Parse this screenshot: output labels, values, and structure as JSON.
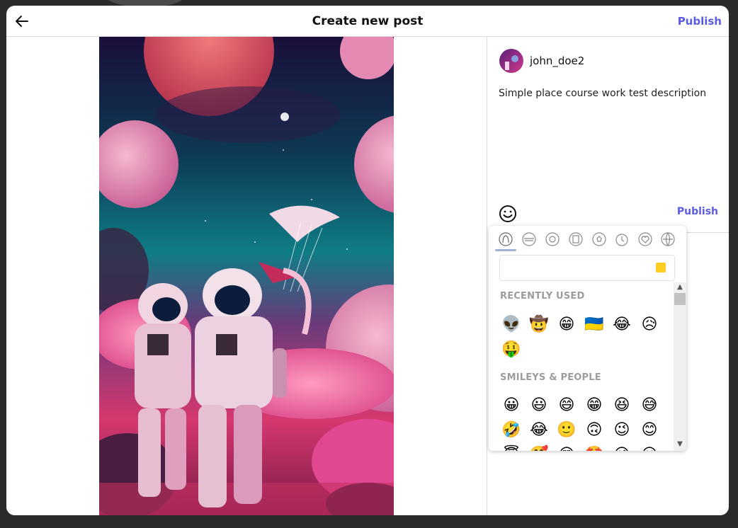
{
  "modal": {
    "title": "Create new post",
    "publish_label": "Publish",
    "back_icon": "arrow-left-icon"
  },
  "image": {
    "description_icon": "post-image"
  },
  "user": {
    "username": "john_doe2"
  },
  "caption": {
    "text": "Simple place course work test description"
  },
  "composer": {
    "emoji_icon": "smiley-icon",
    "publish_label": "Publish"
  },
  "emoji_picker": {
    "categories": [
      "people-icon",
      "food-icon",
      "activity-icon",
      "travel-icon",
      "sports-icon",
      "objects-icon",
      "symbols-icon",
      "flags-icon"
    ],
    "search_placeholder": "",
    "sections": [
      {
        "label": "RECENTLY USED",
        "emojis": [
          "👽",
          "🤠",
          "😁",
          "🇺🇦",
          "😂",
          "😥",
          "🤑"
        ]
      },
      {
        "label": "SMILEYS & PEOPLE",
        "emojis": [
          "😀",
          "😃",
          "😄",
          "😁",
          "😆",
          "😅",
          "🤣",
          "😂",
          "🙂",
          "🙃",
          "😉",
          "😊",
          "😇",
          "🥰",
          "😍",
          "🤩",
          "😘",
          "😗"
        ]
      }
    ]
  },
  "colors": {
    "accent": "#5b5be6",
    "border": "#dbdbdb",
    "skin_tone": "#ffcc22"
  }
}
